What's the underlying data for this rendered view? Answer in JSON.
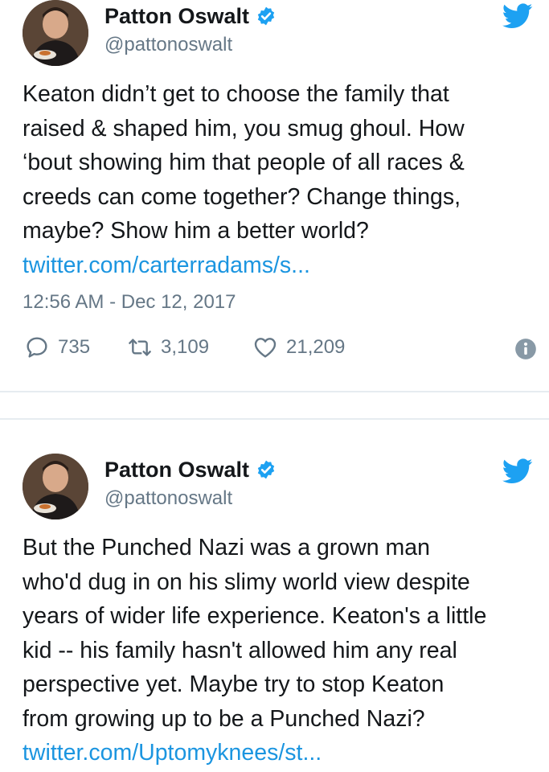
{
  "tweets": [
    {
      "author": {
        "name": "Patton Oswalt",
        "handle": "@pattonoswalt"
      },
      "text": "Keaton didn’t get to choose the family that\nraised & shaped him, you smug ghoul. How\n‘bout showing him that people of all races &\ncreeds can come together? Change things,\nmaybe? Show him a better world?",
      "link": "twitter.com/carterradams/s...",
      "timestamp": "12:56 AM - Dec 12, 2017",
      "stats": {
        "replies": "735",
        "retweets": "3,109",
        "likes": "21,209"
      }
    },
    {
      "author": {
        "name": "Patton Oswalt",
        "handle": "@pattonoswalt"
      },
      "text": "But the Punched Nazi was a grown man\nwho'd dug in on his slimy world view despite\nyears of wider life experience. Keaton's a little\nkid -- his family hasn't allowed him any real\nperspective yet. Maybe try to stop Keaton\nfrom growing up to be a Punched Nazi?",
      "link": "twitter.com/Uptomyknees/st..."
    }
  ],
  "colors": {
    "accent": "#1da1f2",
    "link": "#1b95e0",
    "muted": "#657786",
    "text": "#14171a"
  },
  "icons": [
    "avatar",
    "verified-badge-icon",
    "twitter-bird-icon",
    "reply-icon",
    "retweet-icon",
    "like-heart-icon",
    "info-icon"
  ]
}
